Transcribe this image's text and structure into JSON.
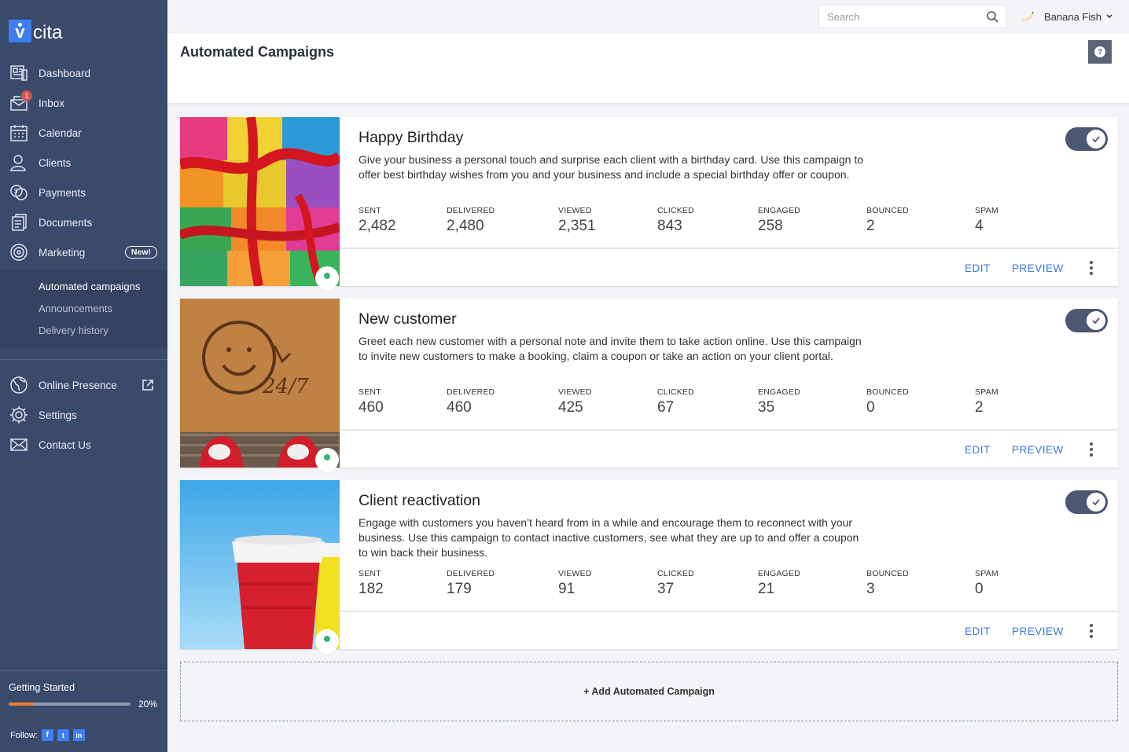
{
  "app": {
    "logo_text": "cita",
    "logo_mark": "v"
  },
  "sidebar": {
    "items": [
      {
        "label": "Dashboard",
        "icon": "dashboard-icon"
      },
      {
        "label": "Inbox",
        "icon": "inbox-icon",
        "badge": "1"
      },
      {
        "label": "Calendar",
        "icon": "calendar-icon"
      },
      {
        "label": "Clients",
        "icon": "clients-icon"
      },
      {
        "label": "Payments",
        "icon": "payments-icon"
      },
      {
        "label": "Documents",
        "icon": "documents-icon"
      },
      {
        "label": "Marketing",
        "icon": "marketing-icon",
        "badge": "New!"
      }
    ],
    "subitems": [
      {
        "label": "Automated campaigns",
        "active": true
      },
      {
        "label": "Announcements"
      },
      {
        "label": "Delivery history"
      }
    ],
    "items2": [
      {
        "label": "Online Presence",
        "icon": "globe-icon"
      },
      {
        "label": "Settings",
        "icon": "gear-icon"
      },
      {
        "label": "Contact Us",
        "icon": "mail-icon"
      }
    ],
    "getting_started": {
      "title": "Getting Started",
      "progress_text": "20%",
      "progress": 0.2
    },
    "follow_label": "Follow:",
    "social": [
      "f",
      "t",
      "in"
    ]
  },
  "topbar": {
    "search_placeholder": "Search",
    "user_name": "Banana Fish"
  },
  "header": {
    "title": "Automated Campaigns"
  },
  "stat_labels": [
    "SENT",
    "DELIVERED",
    "VIEWED",
    "CLICKED",
    "ENGAGED",
    "BOUNCED",
    "SPAM"
  ],
  "actions": {
    "edit": "EDIT",
    "preview": "PREVIEW"
  },
  "campaigns": [
    {
      "title": "Happy Birthday",
      "description": "Give your business a personal touch and surprise each client with a birthday card. Use this campaign to offer best birthday wishes from you and your business and include a special birthday offer or coupon.",
      "stats": [
        "2,482",
        "2,480",
        "2,351",
        "843",
        "258",
        "2",
        "4"
      ],
      "enabled": true
    },
    {
      "title": "New customer",
      "description": "Greet each new customer with a personal note and invite them to take action online. Use this campaign to invite new customers to make a booking, claim a coupon or take an action on your client portal.",
      "stats": [
        "460",
        "460",
        "425",
        "67",
        "35",
        "0",
        "2"
      ],
      "enabled": true
    },
    {
      "title": "Client reactivation",
      "description": "Engage with customers you haven’t heard from in a while and encourage them to reconnect with your business. Use this campaign to contact inactive customers, see what they are up to and offer a coupon to win back their business.",
      "stats": [
        "182",
        "179",
        "91",
        "37",
        "21",
        "3",
        "0"
      ],
      "enabled": true
    }
  ],
  "add_campaign": "+ Add Automated Campaign",
  "colors": {
    "sidebar": "#3a4a6b",
    "accent": "#3a7be0",
    "progress": "#f07b2f",
    "status_active": "#34b57a"
  }
}
